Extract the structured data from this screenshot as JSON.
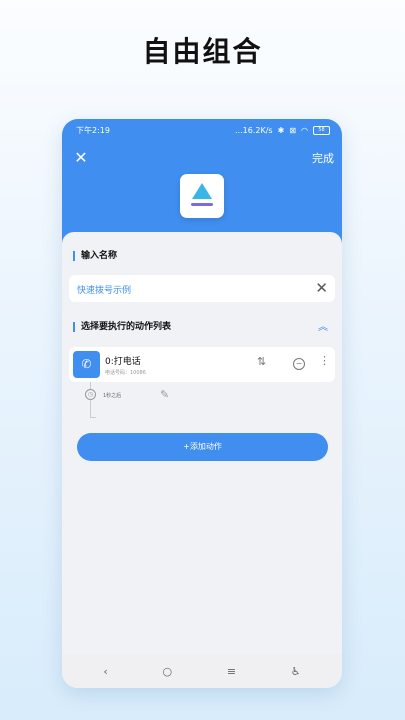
{
  "headline": "自由组合",
  "status": {
    "time": "下午2:19",
    "speed": "...16.2K/s",
    "bt": "✱",
    "battery": "58"
  },
  "toolbar": {
    "close_glyph": "✕",
    "done_label": "完成"
  },
  "name_section": {
    "title": "输入名称",
    "value": "快速拨号示例",
    "clear_glyph": "✕"
  },
  "actions_section": {
    "title": "选择要执行的动作列表",
    "collapse_glyph": "︽"
  },
  "action": {
    "icon_glyph": "✆",
    "title": "0:打电话",
    "subtitle": "电话号码：10086",
    "sort_glyph": "⇅",
    "remove_glyph": "−",
    "more_glyph": "⋮"
  },
  "delay": {
    "clock_glyph": "◷",
    "text": "1秒之后",
    "edit_glyph": "✎"
  },
  "add_action_label": "+添加动作",
  "navbar": {
    "back": "‹",
    "home": "○",
    "menu": "≡",
    "accessibility": "♿"
  },
  "colors": {
    "accent": "#3f8ef0",
    "background": "#f1f2f6"
  }
}
